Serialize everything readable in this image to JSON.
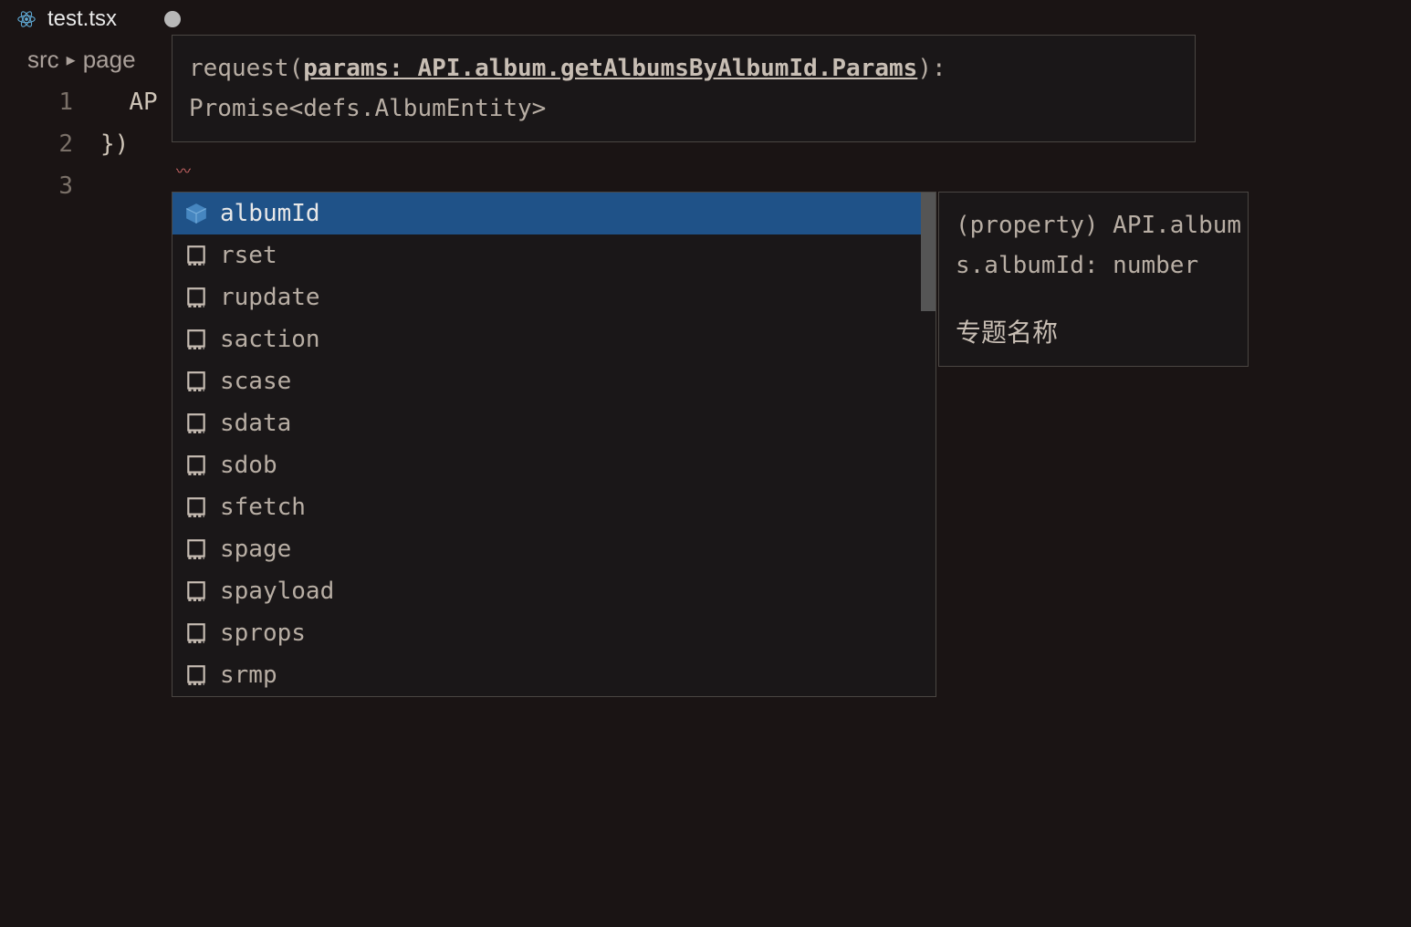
{
  "tab": {
    "label": "test.tsx"
  },
  "breadcrumb": {
    "items": [
      "src",
      "page"
    ]
  },
  "editor": {
    "lines": [
      {
        "num": "1",
        "text": "AP"
      },
      {
        "num": "2",
        "text": ""
      },
      {
        "num": "3",
        "text": "})"
      }
    ]
  },
  "signature": {
    "prefix": "request(",
    "bold": "params: API.album.getAlbumsByAlbumId.Params",
    "suffix": "):",
    "line2": "Promise<defs.AlbumEntity>"
  },
  "autocomplete": {
    "items": [
      {
        "label": "albumId",
        "kind": "property",
        "selected": true
      },
      {
        "label": "rset",
        "kind": "snippet",
        "selected": false
      },
      {
        "label": "rupdate",
        "kind": "snippet",
        "selected": false
      },
      {
        "label": "saction",
        "kind": "snippet",
        "selected": false
      },
      {
        "label": "scase",
        "kind": "snippet",
        "selected": false
      },
      {
        "label": "sdata",
        "kind": "snippet",
        "selected": false
      },
      {
        "label": "sdob",
        "kind": "snippet",
        "selected": false
      },
      {
        "label": "sfetch",
        "kind": "snippet",
        "selected": false
      },
      {
        "label": "spage",
        "kind": "snippet",
        "selected": false
      },
      {
        "label": "spayload",
        "kind": "snippet",
        "selected": false
      },
      {
        "label": "sprops",
        "kind": "snippet",
        "selected": false
      },
      {
        "label": "srmp",
        "kind": "snippet",
        "selected": false
      }
    ]
  },
  "detail": {
    "line1": "(property) API.album",
    "line2": "s.albumId: number",
    "doc": "专题名称"
  }
}
